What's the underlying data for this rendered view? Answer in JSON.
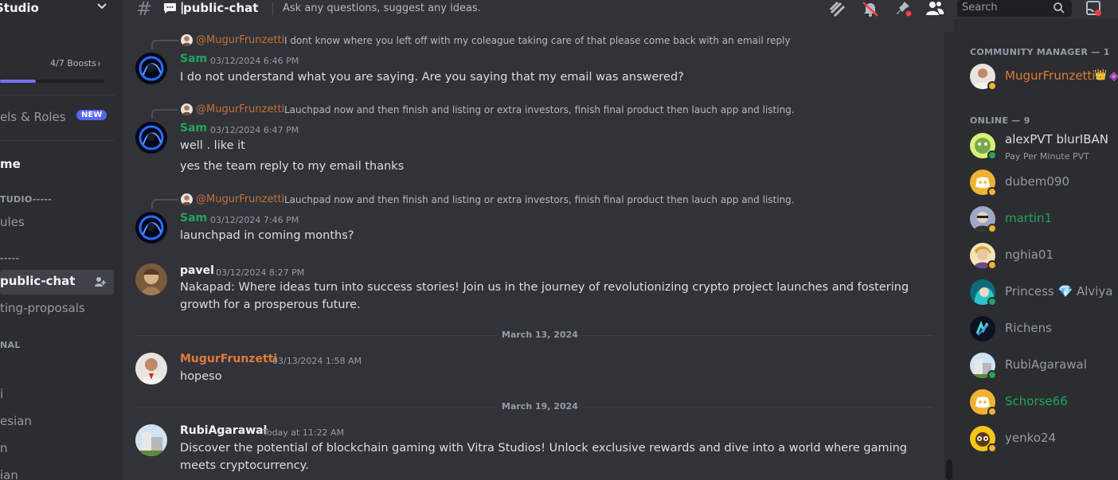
{
  "colors": {
    "bg_main": "#313338",
    "bg_sidebar": "#2b2d31",
    "sam": "#23a55a",
    "manager": "#e07a3a",
    "mention": "#e07a3a",
    "online": "#23a55a",
    "idle": "#f0b232",
    "new_badge": "#5865f2"
  },
  "server": {
    "name": "Studio",
    "boosts": "4/7 Boosts",
    "boost_progress": 0.34
  },
  "sidebar": {
    "channels_roles": "els & Roles",
    "new_badge": "NEW",
    "home": "me",
    "cat_studio": "TUDIO-----",
    "rules": "ules",
    "cat_dashes": "-----",
    "public_chat": "public-chat",
    "voting": "ting-proposals",
    "cat_nal": "NAL",
    "item_i": "i",
    "item_esian": "esian",
    "item_n": "n",
    "item_ian": "ian"
  },
  "header": {
    "channel": "public-chat",
    "topic": "Ask any questions, suggest any ideas.",
    "search_placeholder": "Search"
  },
  "messages": [
    {
      "reply_name": "@MugurFrunzetti",
      "reply_text": "I dont know where you left off with my coleague taking care of that please come back with an email reply",
      "author": "Sam",
      "time": "03/12/2024 6:46 PM",
      "lines": [
        "I do not understand what you are saying. Are you saying that my email was answered?"
      ]
    },
    {
      "reply_name": "@MugurFrunzetti",
      "reply_text": "Lauchpad now and then finish and listing or extra investors, finish final product then lauch app and listing.",
      "author": "Sam",
      "time": "03/12/2024 6:47 PM",
      "lines": [
        "well . like it",
        "yes the team  reply to my email thanks"
      ]
    },
    {
      "reply_name": "@MugurFrunzetti",
      "reply_text": "Lauchpad now and then finish and listing or extra investors, finish final product then lauch app and listing.",
      "author": "Sam",
      "time": "03/12/2024 7:46 PM",
      "lines": [
        "launchpad in coming months?"
      ]
    },
    {
      "author": "pavel",
      "time": "03/12/2024 8:27 PM",
      "lines": [
        "Nakapad: Where ideas turn into success stories! Join us in the journey of revolutionizing crypto project launches and fostering growth for a prosperous future."
      ]
    },
    {
      "author": "MugurFrunzetti",
      "time": "03/13/2024 1:58 AM",
      "lines": [
        "hopeso"
      ]
    },
    {
      "author": "RubiAgarawal",
      "time": "Today at 11:22 AM",
      "lines": [
        "Discover the potential of blockchain gaming with Vitra Studios! Unlock exclusive rewards and dive into a world where gaming meets cryptocurrency."
      ]
    }
  ],
  "day_separators": [
    "March 13, 2024",
    "March 19, 2024"
  ],
  "members": {
    "cat_manager": "COMMUNITY MANAGER — 1",
    "cat_online": "ONLINE — 9",
    "manager": {
      "name": "MugurFrunzetti",
      "crown": "👑",
      "gem": "◈"
    },
    "online": [
      {
        "name": "alexPVT blurIBAN",
        "sub": "Pay Per Minute PVT",
        "status": "online"
      },
      {
        "name": "dubem090",
        "status": "idle"
      },
      {
        "name": "martin1",
        "status": "idle"
      },
      {
        "name": "nghia01",
        "status": "idle"
      },
      {
        "name": "Princess 💎 Alviya",
        "status": "online"
      },
      {
        "name": "Richens",
        "status": "none"
      },
      {
        "name": "RubiAgarawal",
        "status": "online"
      },
      {
        "name": "Schorse66",
        "status": "idle"
      },
      {
        "name": "yenko24",
        "status": "idle"
      }
    ]
  }
}
